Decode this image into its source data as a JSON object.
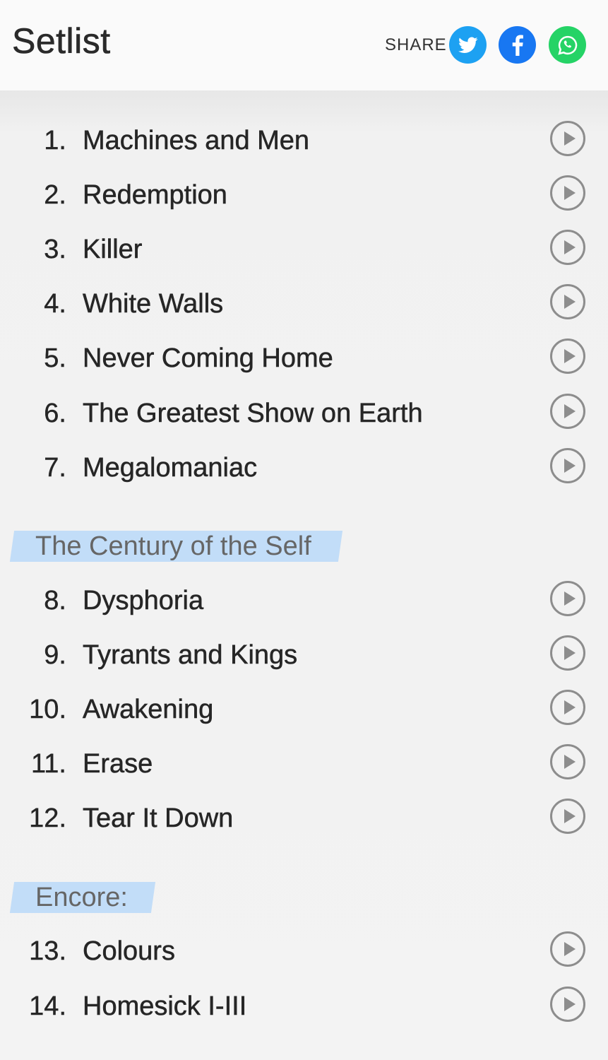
{
  "header": {
    "title": "Setlist",
    "share_label": "SHARE",
    "share_buttons": [
      {
        "network": "twitter",
        "icon": "twitter-bird-icon",
        "color": "#1da1f2"
      },
      {
        "network": "facebook",
        "icon": "facebook-f-icon",
        "color": "#1877f2"
      },
      {
        "network": "whatsapp",
        "icon": "whatsapp-phone-icon",
        "color": "#25d366"
      }
    ]
  },
  "play_icon": "play-circle-icon",
  "sections": [
    {
      "heading": "",
      "songs": [
        {
          "num": "1.",
          "title": "Machines and Men"
        },
        {
          "num": "2.",
          "title": "Redemption"
        },
        {
          "num": "3.",
          "title": "Killer"
        },
        {
          "num": "4.",
          "title": "White Walls"
        },
        {
          "num": "5.",
          "title": "Never Coming Home"
        },
        {
          "num": "6.",
          "title": "The Greatest Show on Earth"
        },
        {
          "num": "7.",
          "title": "Megalomaniac"
        }
      ]
    },
    {
      "heading": "The Century of the Self",
      "songs": [
        {
          "num": "8.",
          "title": "Dysphoria"
        },
        {
          "num": "9.",
          "title": "Tyrants and Kings"
        },
        {
          "num": "10.",
          "title": "Awakening"
        },
        {
          "num": "11.",
          "title": "Erase"
        },
        {
          "num": "12.",
          "title": "Tear It Down"
        }
      ]
    },
    {
      "heading": "Encore:",
      "songs": [
        {
          "num": "13.",
          "title": "Colours"
        },
        {
          "num": "14.",
          "title": "Homesick I-III"
        }
      ]
    }
  ],
  "colors": {
    "highlight": "#bcdaf8",
    "play_icon": "#8d8d8d"
  }
}
